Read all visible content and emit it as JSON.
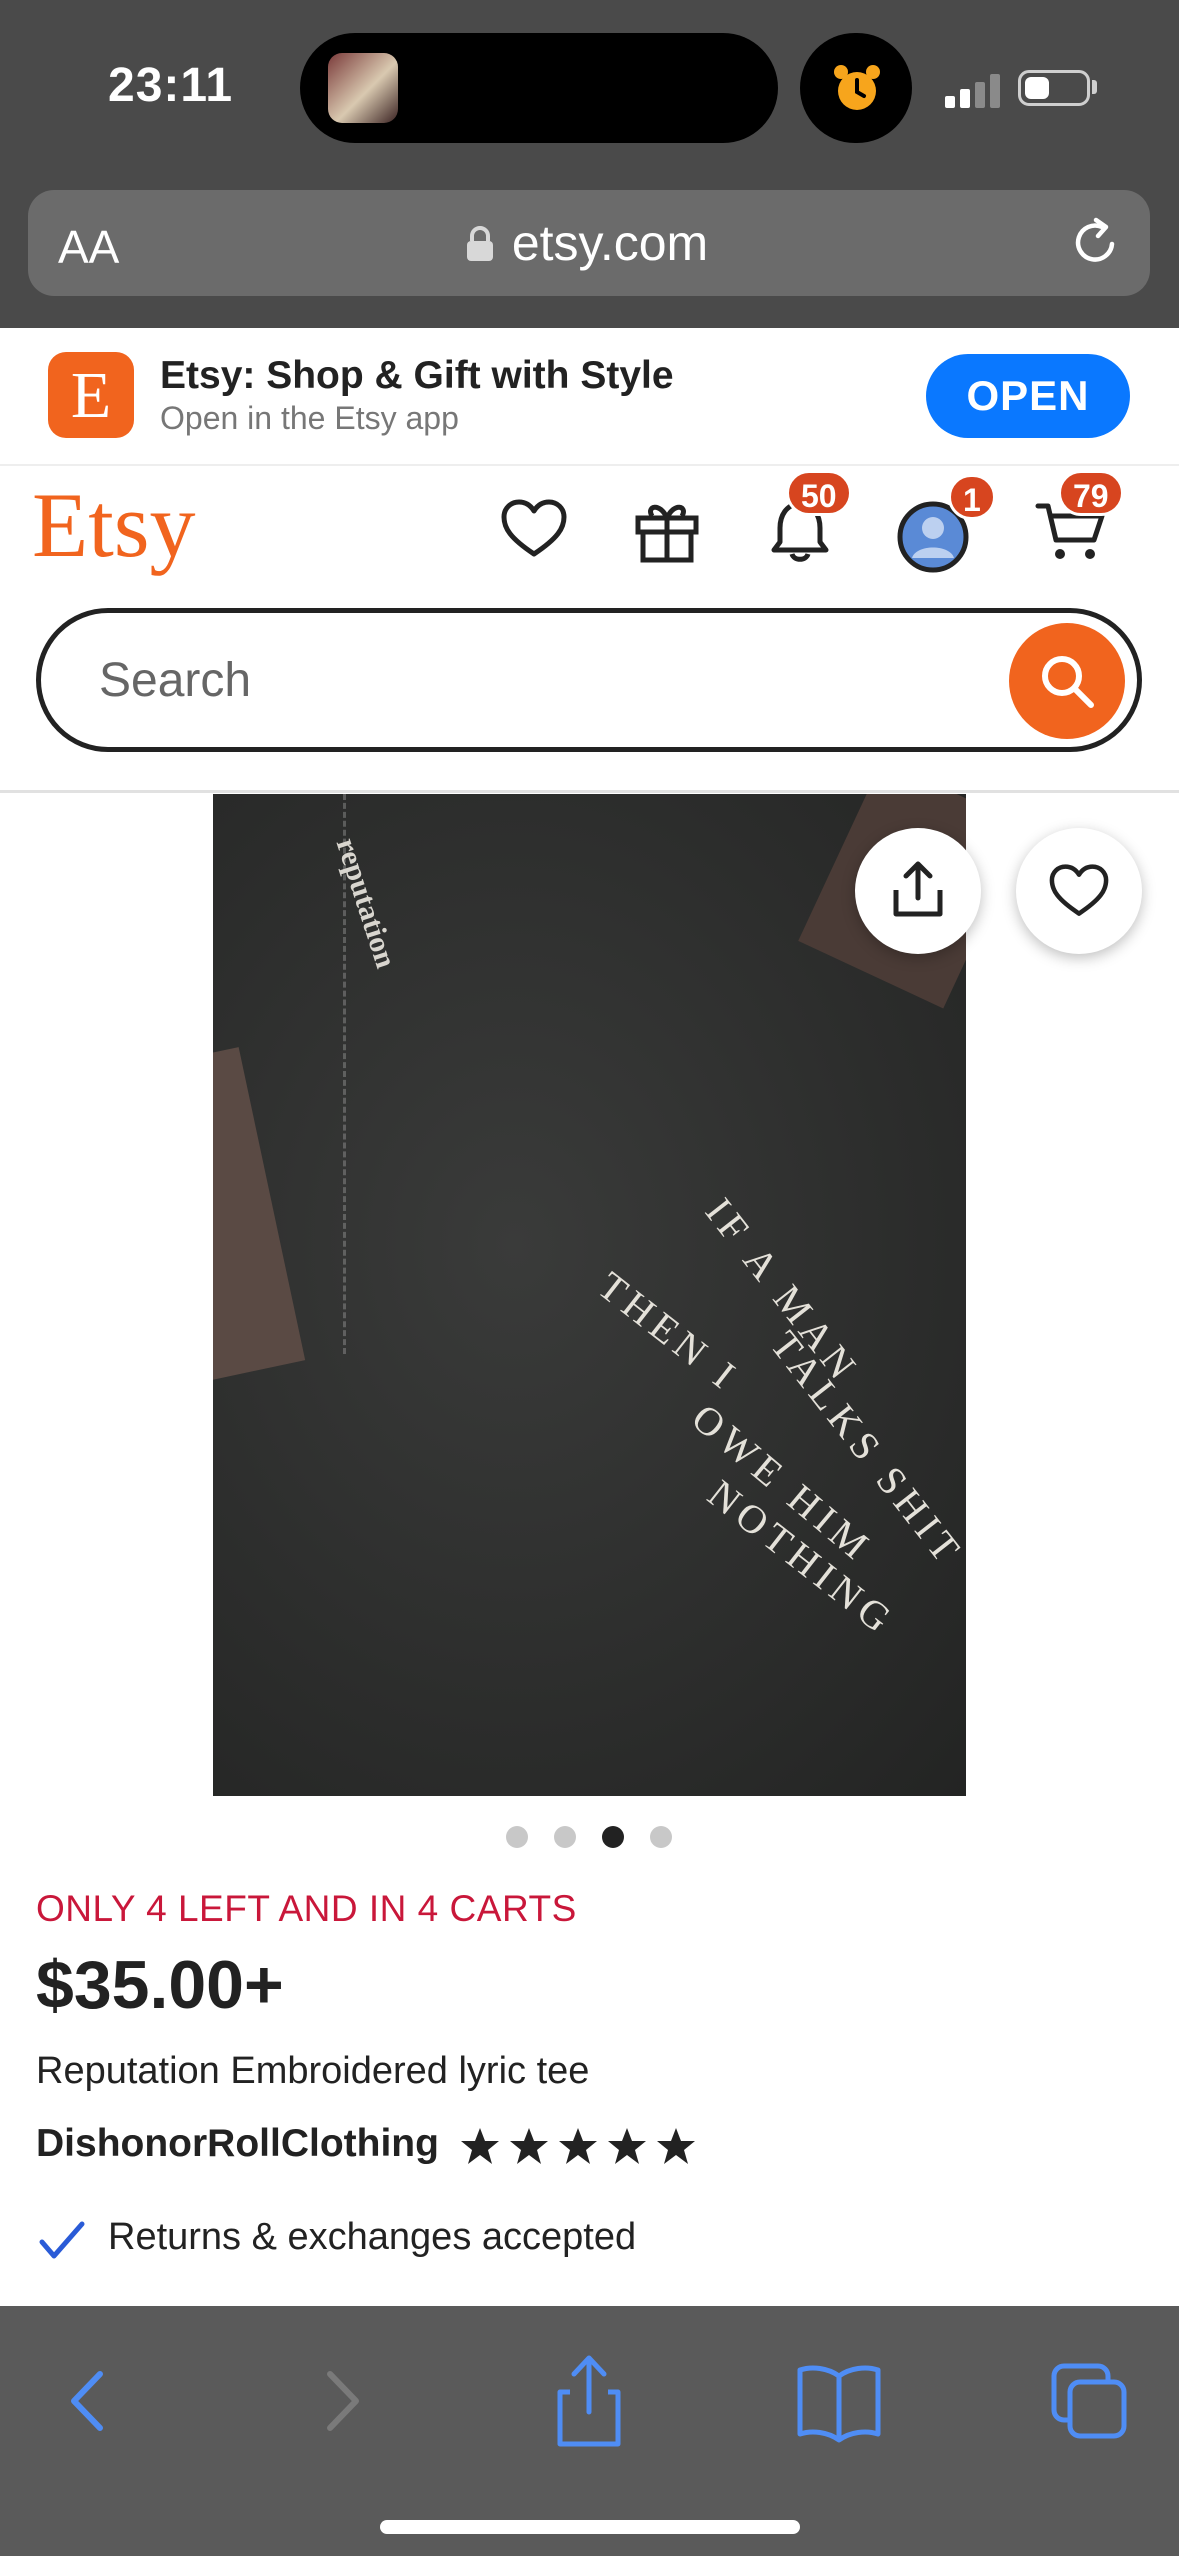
{
  "status_bar": {
    "time": "23:11"
  },
  "browser": {
    "text_size_label": "AA",
    "url": "etsy.com"
  },
  "app_banner": {
    "title": "Etsy: Shop & Gift with Style",
    "subtitle": "Open in the Etsy app",
    "icon_letter": "E",
    "open_label": "OPEN"
  },
  "header": {
    "logo": "Etsy",
    "notifications_count": "50",
    "account_count": "1",
    "cart_count": "79"
  },
  "search": {
    "placeholder": "Search"
  },
  "product_image": {
    "sleeve_text": "reputation",
    "lyric_lines": [
      "IF A MAN",
      "TALKS SHIT",
      "THEN I",
      "OWE HIM",
      "NOTHING"
    ],
    "dots_total": 4,
    "active_dot": 3
  },
  "listing": {
    "stock_notice": "ONLY 4 LEFT AND IN 4 CARTS",
    "price": "$35.00+",
    "title": "Reputation Embroidered lyric tee",
    "shop_name": "DishonorRollClothing",
    "rating_stars": 5,
    "returns": "Returns & exchanges accepted"
  },
  "colors": {
    "etsy_orange": "#f1641e",
    "open_blue": "#0a78ff",
    "stock_red": "#c9173a",
    "badge_red": "#d7451f",
    "safari_blue": "#3b82f6"
  }
}
